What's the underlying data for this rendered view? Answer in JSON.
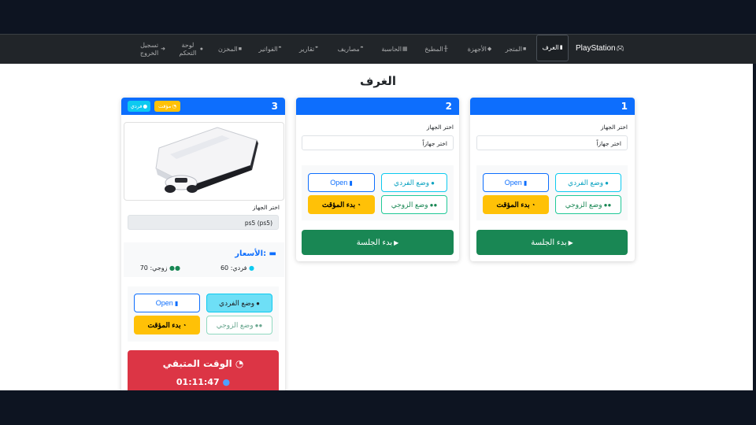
{
  "navbar": {
    "brand": "PlayStation",
    "items": [
      {
        "label": "الغرف",
        "active": true
      },
      {
        "label": "المتجر"
      },
      {
        "label": "الأجهزة"
      },
      {
        "label": "المطبخ"
      },
      {
        "label": "الحاسبة"
      },
      {
        "label": "مصاريف"
      },
      {
        "label": "تقارير"
      },
      {
        "label": "الفواتير"
      },
      {
        "label": "المخزن"
      },
      {
        "label": "لوحة التحكم"
      },
      {
        "label": "تسجيل الخروج"
      }
    ]
  },
  "page": {
    "title": "الغرف"
  },
  "rooms": [
    {
      "number": "1",
      "select_label": "اختر الجهاز",
      "select_value": "اختر جهازاً",
      "buttons": {
        "single": "وضع الفردي",
        "open": "Open",
        "double": "وضع الزوجي",
        "timer": "بدء المؤقت",
        "start": "بدء الجلسة"
      }
    },
    {
      "number": "2",
      "select_label": "اختر الجهاز",
      "select_value": "اختر جهازاً",
      "buttons": {
        "single": "وضع الفردي",
        "open": "Open",
        "double": "وضع الزوجي",
        "timer": "بدء المؤقت",
        "start": "بدء الجلسة"
      }
    },
    {
      "number": "3",
      "badges": {
        "timer": "مؤقت",
        "single": "فردي"
      },
      "select_label": "اختر الجهاز",
      "select_value": "ps5 (ps5)",
      "prices": {
        "title": "الأسعار:",
        "single": "فردي: 60",
        "double": "زوجي: 70"
      },
      "buttons": {
        "single": "وضع الفردي",
        "open": "Open",
        "double": "وضع الزوجي",
        "timer": "بدء المؤقت"
      },
      "remaining": {
        "title": "الوقت المتبقي",
        "value": "01:11:47"
      }
    }
  ],
  "colors": {
    "navbar": "#212529",
    "primary": "#0d6efd",
    "success": "#198754",
    "warning": "#ffc107",
    "danger": "#dc3545",
    "info": "#0dcaf0"
  },
  "icons": {
    "brand": "gamepad-icon",
    "rooms": "door-icon",
    "store": "bag-icon",
    "devices": "gamepad-icon",
    "kitchen": "utensils-icon",
    "calculator": "calculator-icon",
    "expenses": "quote-icon",
    "reports": "quote-icon",
    "invoices": "quote-icon",
    "warehouse": "box-icon",
    "dashboard": "user-gear-icon",
    "logout": "sign-out-icon"
  }
}
